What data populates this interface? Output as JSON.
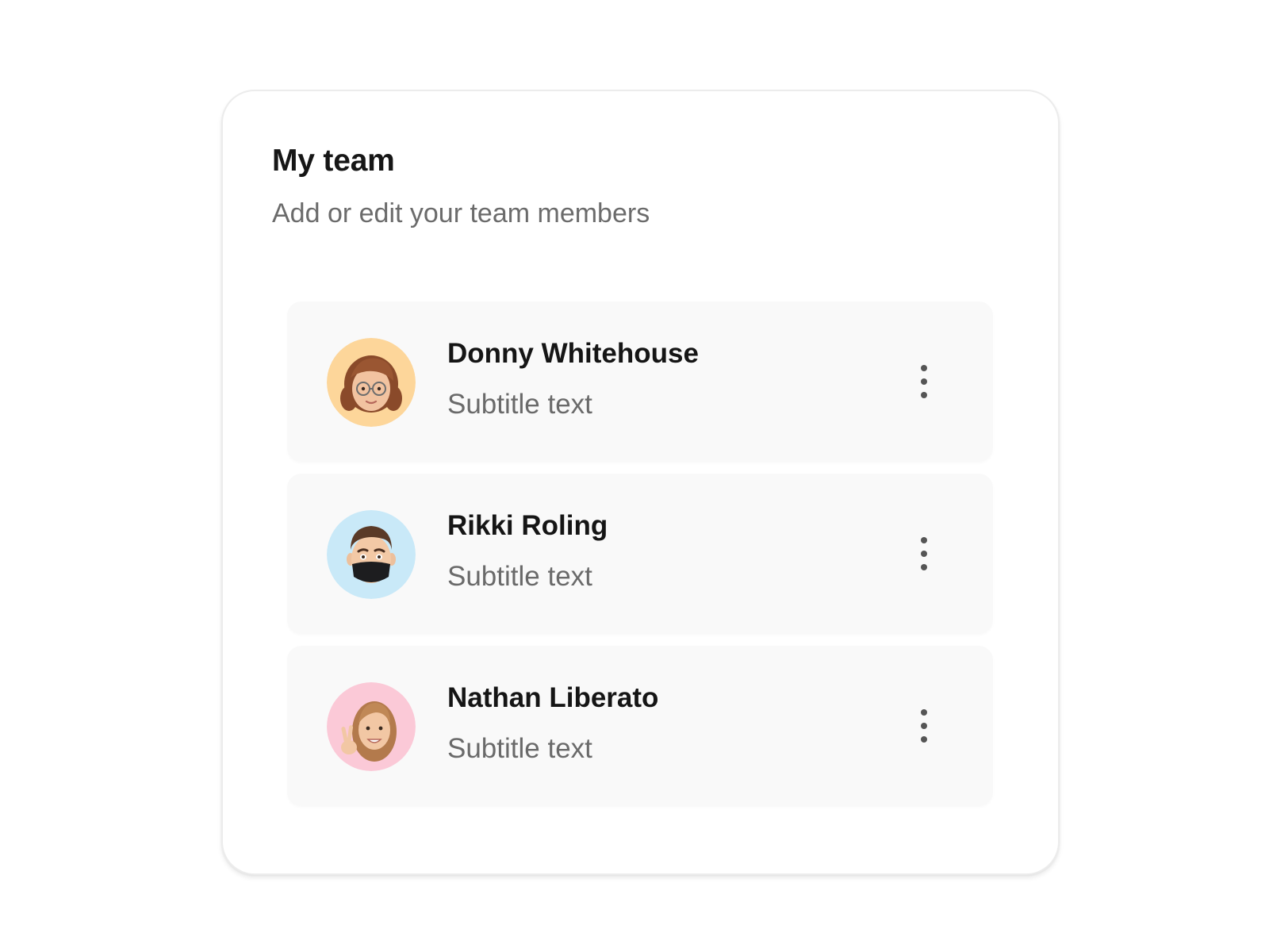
{
  "card": {
    "title": "My team",
    "subtitle": "Add or edit your team members"
  },
  "members": [
    {
      "name": "Donny Whitehouse",
      "subtitle": "Subtitle text",
      "avatar_bg": "#FDD69A",
      "avatar_icon": "memoji-woman-glasses-icon"
    },
    {
      "name": "Rikki Roling",
      "subtitle": "Subtitle text",
      "avatar_bg": "#C9E9F8",
      "avatar_icon": "memoji-man-mask-icon"
    },
    {
      "name": "Nathan Liberato",
      "subtitle": "Subtitle text",
      "avatar_bg": "#FBC9D7",
      "avatar_icon": "memoji-peace-sign-icon"
    }
  ],
  "colors": {
    "row_bg": "#F9F9F9",
    "title": "#161616",
    "subtitle": "#6B6B6B",
    "dots": "#555555"
  }
}
